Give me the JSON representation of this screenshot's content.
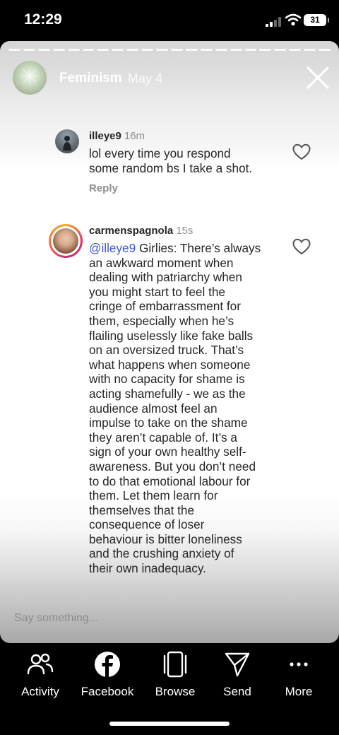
{
  "status_bar": {
    "time": "12:29",
    "battery": "31"
  },
  "story": {
    "title": "Feminism",
    "date": "May 4",
    "input_placeholder": "Say something..."
  },
  "comments": [
    {
      "username": "illeye9",
      "time": "16m",
      "text_lines": [
        "lol every time you respond",
        "some random bs I take a shot."
      ],
      "reply_label": "Reply"
    },
    {
      "username": "carmenspagnola",
      "time": "15s",
      "mention": "@illeye9",
      "first_line_rest": " Girlies: There’s always",
      "text_lines": [
        "an awkward moment when",
        "dealing with patriarchy when",
        "you might start to feel the",
        "cringe of embarrassment for",
        "them, especially when he’s",
        "flailing uselessly like fake balls",
        "on an oversized truck. That’s",
        "what happens when someone",
        "with no capacity for shame is",
        "acting shamefully - we as the",
        "audience almost feel an",
        "impulse to take on the shame",
        "they aren’t capable of. It’s a",
        "sign of your own healthy self-",
        "awareness. But you don’t need",
        "to do that emotional labour for",
        "them. Let them learn for",
        "themselves that the",
        "consequence of loser",
        "behaviour is bitter loneliness",
        "and the crushing anxiety of",
        "their own inadequacy."
      ]
    }
  ],
  "nav": {
    "items": [
      {
        "label": "Activity",
        "icon": "activity-icon"
      },
      {
        "label": "Facebook",
        "icon": "facebook-icon"
      },
      {
        "label": "Browse",
        "icon": "browse-icon"
      },
      {
        "label": "Send",
        "icon": "send-icon"
      },
      {
        "label": "More",
        "icon": "more-icon"
      }
    ]
  },
  "colors": {
    "mention": "#3d5bc9",
    "story_ring": "#e1306c"
  }
}
